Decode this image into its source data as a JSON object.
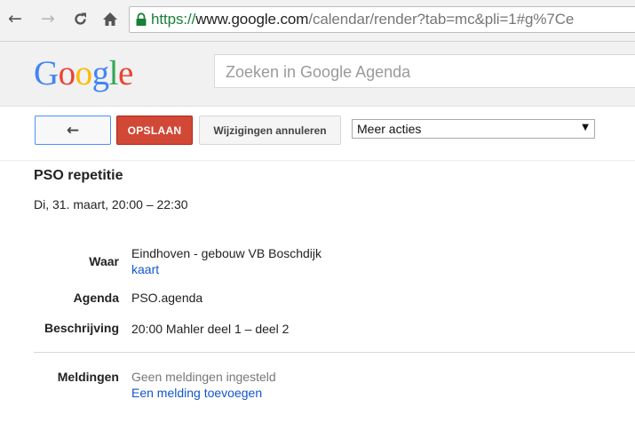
{
  "browser": {
    "url_scheme": "https://",
    "url_host": "www.google.com",
    "url_path": "/calendar/render?tab=mc&pli=1#g%7Ce",
    "icons": [
      "back-arrow-icon",
      "forward-arrow-icon",
      "reload-icon",
      "home-icon",
      "lock-icon"
    ]
  },
  "header": {
    "logo_letters": [
      {
        "char": "G",
        "color": "#4285f4"
      },
      {
        "char": "o",
        "color": "#ea4335"
      },
      {
        "char": "o",
        "color": "#fbbc05"
      },
      {
        "char": "g",
        "color": "#4285f4"
      },
      {
        "char": "l",
        "color": "#34a853"
      },
      {
        "char": "e",
        "color": "#ea4335"
      }
    ],
    "search_placeholder": "Zoeken in Google Agenda"
  },
  "toolbar": {
    "back_icon": "back-arrow-icon",
    "save_label": "OPSLAAN",
    "cancel_label": "Wijzigingen annuleren",
    "more_actions": "Meer acties"
  },
  "event": {
    "title": "PSO repetitie",
    "datetime": "Di, 31. maart, 20:00 – 22:30",
    "where_label": "Waar",
    "where_value": "Eindhoven - gebouw VB Boschdijk",
    "map_link": "kaart",
    "calendar_label": "Agenda",
    "calendar_value": "PSO.agenda",
    "description_label": "Beschrijving",
    "description_value": "20:00 Mahler deel 1 – deel 2",
    "notifications_label": "Meldingen",
    "notifications_value": "Geen meldingen ingesteld",
    "add_notification": "Een melding toevoegen"
  },
  "colors": {
    "save_button": "#d14836",
    "link": "#1155cc",
    "url_secure": "#188038"
  }
}
